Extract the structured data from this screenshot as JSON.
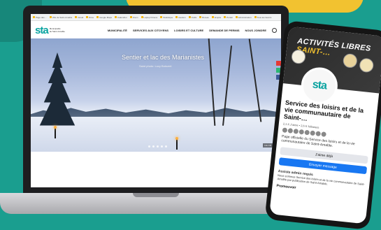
{
  "browser": {
    "bookmarks": [
      "Page des…",
      "Ville de Saint-Amable",
      "Gmail",
      "Drive",
      "Google Maps",
      "Calendrier",
      "Zoom",
      "Laptop Fitness",
      "Statistique",
      "Gestion",
      "Outils",
      "Bureau",
      "Emploi",
      "Portail",
      "Administration",
      "Tous les favoris"
    ]
  },
  "site": {
    "logo_main": "sta",
    "logo_line1": "Municipalité",
    "logo_line2": "de Saint-Amable",
    "nav": [
      "MUNICIPALITÉ",
      "SERVICES AUX CITOYENS",
      "LOISIRS ET CULTURE",
      "DEMANDE DE PERMIS",
      "NOUS JOINDRE"
    ],
    "hero_title": "Sentier et lac des Marianistes",
    "hero_subtitle": "Saint photo: Lucy Boisvert",
    "hero_credit": "Info FR"
  },
  "facebook": {
    "cover_title_a": "ACTIVITÉS LIBRES",
    "cover_title_b": "SAINT-…",
    "profile_logo": "sta",
    "page_name": "Service des loisirs et de la vie communautaire de Saint-…",
    "followers": "2,1 K J'aime • 2,6 K followers",
    "description": "Page officielle du Service des loisirs et de la vie communautaire de Saint-Amable.",
    "like_label": "J'aime déjà",
    "message_label": "Envoyer message",
    "info_title": "Assiste admin requis",
    "info_text": "Nous sommes Service des loisirs et de la vie communautaire de Saint-Amable par publication de Saint-Amable.",
    "promo_label": "Promouvoir"
  }
}
